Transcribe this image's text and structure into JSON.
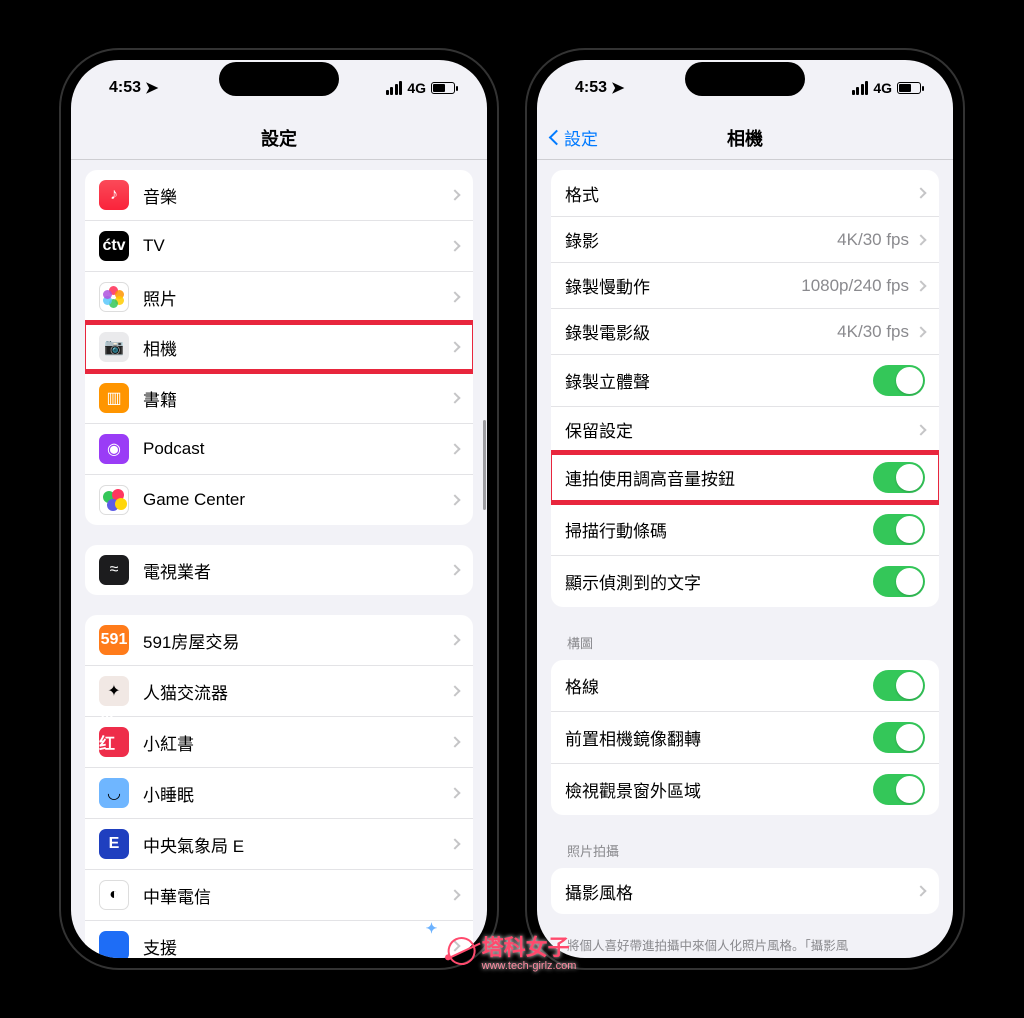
{
  "status": {
    "time": "4:53",
    "network": "4G"
  },
  "left": {
    "title": "設定",
    "group1": [
      {
        "iconClass": "ic-music",
        "iconName": "music-icon",
        "glyph": "♪",
        "label": "音樂"
      },
      {
        "iconClass": "ic-tv",
        "iconName": "tv-icon",
        "glyph": "ćtv",
        "label": "TV"
      },
      {
        "iconClass": "ic-photos",
        "iconName": "photos-icon",
        "glyph": "_photos",
        "label": "照片"
      },
      {
        "iconClass": "ic-camera",
        "iconName": "camera-icon",
        "glyph": "📷",
        "label": "相機",
        "highlight": true
      },
      {
        "iconClass": "ic-books",
        "iconName": "books-icon",
        "glyph": "▥",
        "label": "書籍"
      },
      {
        "iconClass": "ic-podcast",
        "iconName": "podcast-icon",
        "glyph": "◉",
        "label": "Podcast"
      },
      {
        "iconClass": "ic-gc",
        "iconName": "game-center-icon",
        "glyph": "_gc",
        "label": "Game Center"
      }
    ],
    "group2": [
      {
        "iconClass": "ic-tvp",
        "iconName": "tv-provider-icon",
        "glyph": "≈",
        "label": "電視業者"
      }
    ],
    "group3": [
      {
        "iconClass": "ic-591",
        "iconName": "app-591-icon",
        "glyph": "591",
        "label": "591房屋交易"
      },
      {
        "iconClass": "ic-cat",
        "iconName": "app-cat-icon",
        "glyph": "✦",
        "label": "人猫交流器"
      },
      {
        "iconClass": "ic-xhs",
        "iconName": "app-xhs-icon",
        "glyph": "小红书",
        "label": "小紅書"
      },
      {
        "iconClass": "ic-sleep",
        "iconName": "app-sleep-icon",
        "glyph": "◡",
        "label": "小睡眠"
      },
      {
        "iconClass": "ic-cwb",
        "iconName": "app-cwb-icon",
        "glyph": "E",
        "label": "中央氣象局 E"
      },
      {
        "iconClass": "ic-cht",
        "iconName": "app-cht-icon",
        "glyph": "◐",
        "label": "中華電信"
      },
      {
        "iconClass": "ic-sup",
        "iconName": "app-support-icon",
        "glyph": "",
        "label": "支援"
      }
    ]
  },
  "right": {
    "back": "設定",
    "title": "相機",
    "group1": [
      {
        "label": "格式",
        "type": "chev"
      },
      {
        "label": "錄影",
        "detail": "4K/30 fps",
        "type": "chev"
      },
      {
        "label": "錄製慢動作",
        "detail": "1080p/240 fps",
        "type": "chev"
      },
      {
        "label": "錄製電影級",
        "detail": "4K/30 fps",
        "type": "chev"
      },
      {
        "label": "錄製立體聲",
        "type": "toggle",
        "on": true
      },
      {
        "label": "保留設定",
        "type": "chev"
      },
      {
        "label": "連拍使用調高音量按鈕",
        "type": "toggle",
        "on": true,
        "highlight": true
      },
      {
        "label": "掃描行動條碼",
        "type": "toggle",
        "on": true
      },
      {
        "label": "顯示偵測到的文字",
        "type": "toggle",
        "on": true
      }
    ],
    "sec2Header": "構圖",
    "group2": [
      {
        "label": "格線",
        "type": "toggle",
        "on": true
      },
      {
        "label": "前置相機鏡像翻轉",
        "type": "toggle",
        "on": true
      },
      {
        "label": "檢視觀景窗外區域",
        "type": "toggle",
        "on": true
      }
    ],
    "sec3Header": "照片拍攝",
    "group3": [
      {
        "label": "攝影風格",
        "type": "link"
      }
    ],
    "footer": "將個人喜好帶進拍攝中來個人化照片風格。「攝影風"
  },
  "watermark": {
    "text": "塔科女子",
    "sub": "www.tech-girlz.com"
  }
}
